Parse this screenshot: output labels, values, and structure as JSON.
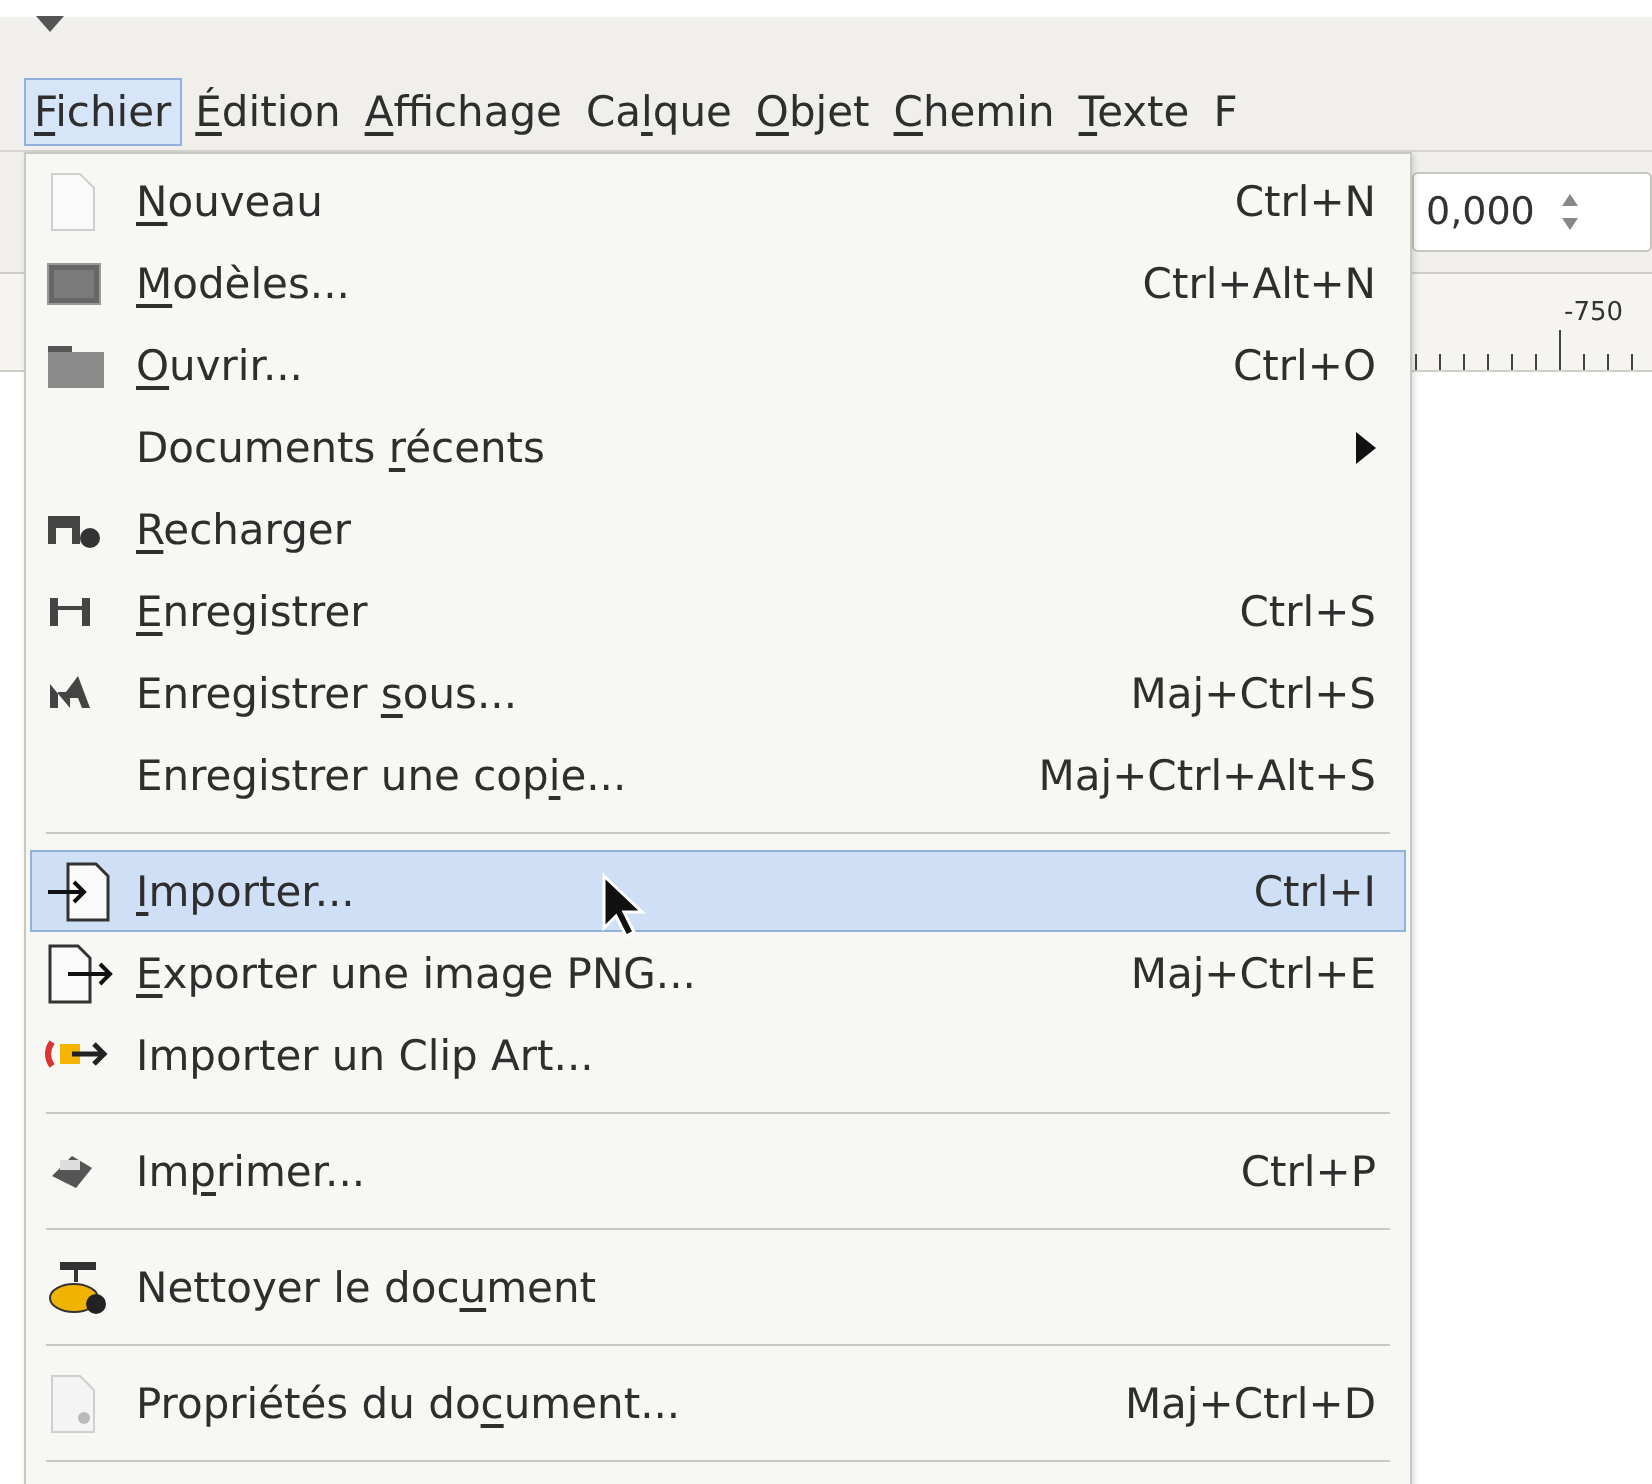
{
  "menubar": [
    {
      "label": {
        "key": "F",
        "rest": "ichier"
      },
      "selected": true
    },
    {
      "label": {
        "key": "É",
        "rest": "dition"
      },
      "selected": false
    },
    {
      "label": {
        "key": "A",
        "rest": "ffichage"
      },
      "selected": false
    },
    {
      "label": {
        "pre": "Ca",
        "key": "l",
        "rest": "que"
      },
      "selected": false
    },
    {
      "label": {
        "key": "O",
        "rest": "bjet"
      },
      "selected": false
    },
    {
      "label": {
        "key": "C",
        "rest": "hemin"
      },
      "selected": false
    },
    {
      "label": {
        "key": "T",
        "rest": "exte"
      },
      "selected": false
    },
    {
      "label": {
        "pre": "F"
      },
      "selected": false
    }
  ],
  "toolbar": {
    "spin_value": "0,000"
  },
  "ruler": {
    "label": "-750"
  },
  "menu": [
    {
      "kind": "item",
      "label": {
        "key": "N",
        "rest": "ouveau"
      },
      "shortcut": "Ctrl+N",
      "selected": false
    },
    {
      "kind": "item",
      "label": {
        "key": "M",
        "rest": "odèles..."
      },
      "shortcut": "Ctrl+Alt+N",
      "selected": false
    },
    {
      "kind": "item",
      "label": {
        "key": "O",
        "rest": "uvrir..."
      },
      "shortcut": "Ctrl+O",
      "selected": false
    },
    {
      "kind": "submenu",
      "label": {
        "pre": "Documents ",
        "key": "r",
        "rest": "écents"
      },
      "selected": false
    },
    {
      "kind": "item",
      "label": {
        "key": "R",
        "rest": "echarger"
      },
      "selected": false
    },
    {
      "kind": "item",
      "label": {
        "key": "E",
        "rest": "nregistrer"
      },
      "shortcut": "Ctrl+S",
      "selected": false
    },
    {
      "kind": "item",
      "label": {
        "pre": "Enregistrer ",
        "key": "s",
        "rest": "ous..."
      },
      "shortcut": "Maj+Ctrl+S",
      "selected": false
    },
    {
      "kind": "item",
      "label": {
        "pre": "Enregistrer une cop",
        "key": "i",
        "rest": "e..."
      },
      "shortcut": "Maj+Ctrl+Alt+S",
      "selected": false
    },
    {
      "kind": "separator"
    },
    {
      "kind": "item",
      "label": {
        "key": "I",
        "rest": "mporter..."
      },
      "shortcut": "Ctrl+I",
      "selected": true
    },
    {
      "kind": "item",
      "label": {
        "key": "E",
        "rest": "xporter une image PNG..."
      },
      "shortcut": "Maj+Ctrl+E",
      "selected": false
    },
    {
      "kind": "item",
      "label": {
        "pre": "Importer un Clip Art..."
      },
      "selected": false
    },
    {
      "kind": "separator"
    },
    {
      "kind": "item",
      "label": {
        "pre": "Im",
        "key": "p",
        "rest": "rimer..."
      },
      "shortcut": "Ctrl+P",
      "selected": false
    },
    {
      "kind": "separator"
    },
    {
      "kind": "item",
      "label": {
        "pre": "Nettoyer le doc",
        "key": "u",
        "rest": "ment"
      },
      "selected": false
    },
    {
      "kind": "separator"
    },
    {
      "kind": "item",
      "label": {
        "pre": "Propriétés du do",
        "key": "c",
        "rest": "ument..."
      },
      "shortcut": "Maj+Ctrl+D",
      "selected": false
    },
    {
      "kind": "separator"
    }
  ]
}
